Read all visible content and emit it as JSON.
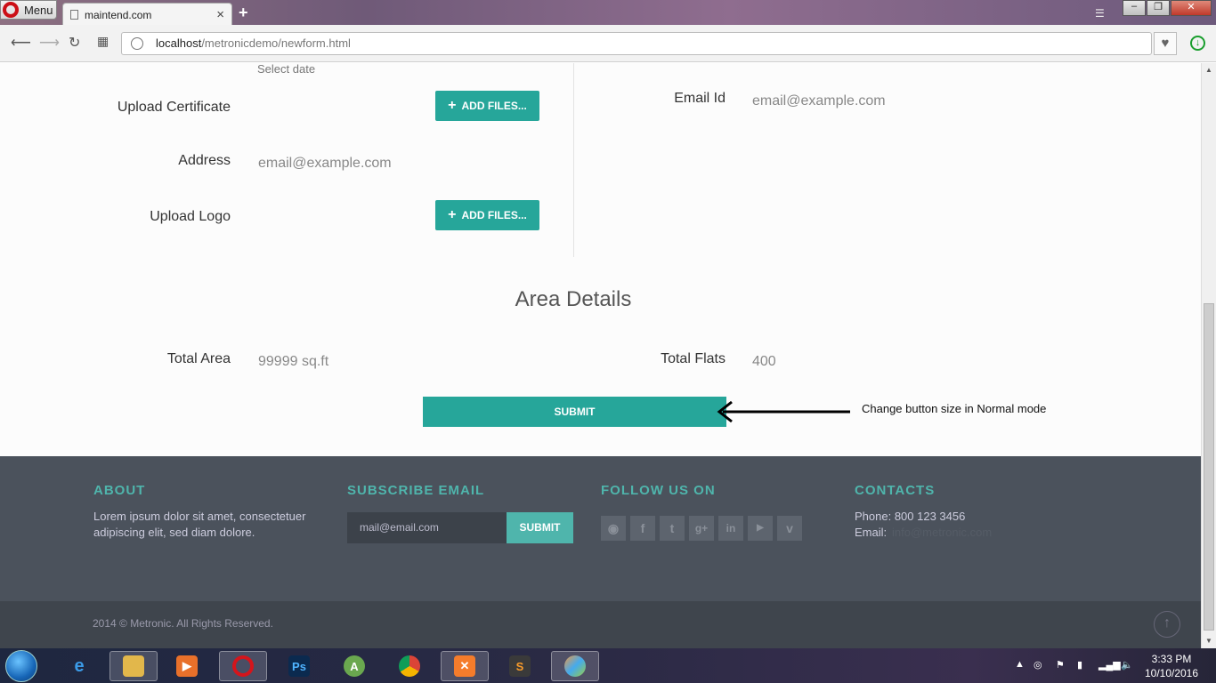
{
  "browser": {
    "menu_label": "Menu",
    "tab_title": "maintend.com",
    "url_host": "localhost",
    "url_path": "/metronicdemo/newform.html"
  },
  "form": {
    "date_help": "Select date",
    "upload_certificate_label": "Upload Certificate",
    "add_files_label": "ADD FILES...",
    "email_label": "Email Id",
    "email_value": "email@example.com",
    "address_label": "Address",
    "address_value": "email@example.com",
    "upload_logo_label": "Upload Logo",
    "add_files_label_2": "ADD FILES..."
  },
  "area": {
    "title": "Area Details",
    "total_area_label": "Total Area",
    "total_area_value": "99999 sq.ft",
    "total_flats_label": "Total Flats",
    "total_flats_value": "400",
    "submit_label": "SUBMIT",
    "annotation": "Change button size in Normal mode"
  },
  "footer": {
    "about_title": "ABOUT",
    "about_text": "Lorem ipsum dolor sit amet, consectetuer adipiscing elit, sed diam dolore.",
    "subscribe_title": "SUBSCRIBE EMAIL",
    "subscribe_placeholder": "mail@email.com",
    "subscribe_button": "SUBMIT",
    "follow_title": "FOLLOW US ON",
    "social_icons": [
      "rss-icon",
      "facebook-icon",
      "twitter-icon",
      "google-plus-icon",
      "linkedin-icon",
      "youtube-icon",
      "vimeo-icon"
    ],
    "contacts_title": "CONTACTS",
    "phone": "Phone: 800 123 3456",
    "email_label": "Email:",
    "email_link": "info@metronic.com",
    "copyright": "2014 © Metronic. All Rights Reserved."
  },
  "taskbar": {
    "time": "3:33 PM",
    "date": "10/10/2016"
  },
  "colors": {
    "accent": "#26a69a",
    "footer_bg": "#4b525c",
    "footer_heading": "#4fb5ac"
  }
}
